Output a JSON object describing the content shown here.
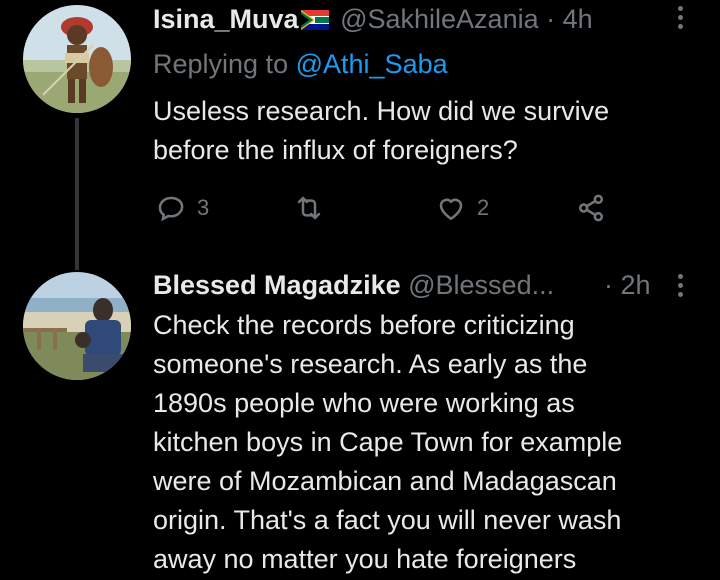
{
  "tweet1": {
    "display_name": "Isina_Muva",
    "flag_icon": "south-africa-flag-icon",
    "handle": "@SakhileAzania",
    "separator": "·",
    "time": "4h",
    "reply_prefix": "Replying to",
    "reply_target": "@Athi_Saba",
    "text_line1": "Useless research. How did we survive",
    "text_line2": "before the influx of foreigners?",
    "reply_count": "3",
    "like_count": "2"
  },
  "tweet2": {
    "display_name": "Blessed Magadzike",
    "handle": "@Blessed...",
    "separator": "·",
    "time": "2h",
    "lines": [
      "Check the records before criticizing",
      "someone's research. As early as the",
      "1890s people who were working as",
      "kitchen boys in Cape Town for example",
      "were of Mozambican and Madagascan",
      "origin. That's a fact you will never wash",
      "away no matter you hate foreigners"
    ]
  },
  "colors": {
    "background": "#000000",
    "text": "#e7e9ea",
    "muted": "#71767b",
    "link": "#1d9bf0",
    "thread_line": "#333639"
  }
}
